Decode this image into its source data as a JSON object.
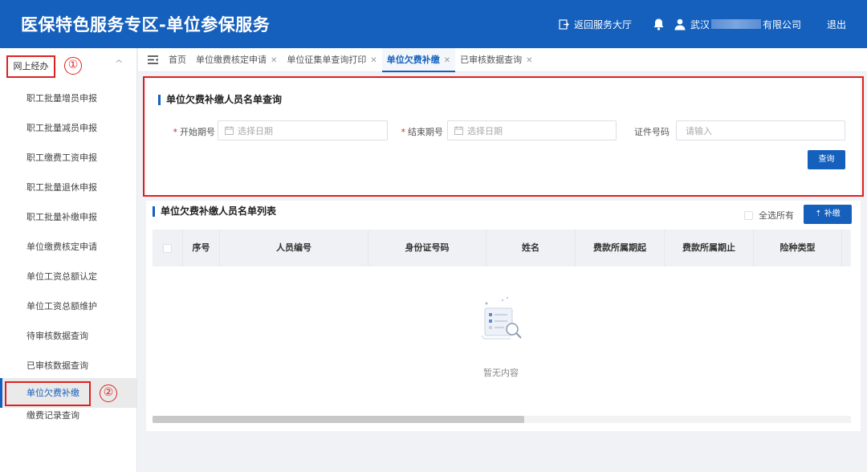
{
  "header": {
    "title": "医保特色服务专区-单位参保服务",
    "return_label": "返回服务大厅",
    "company_prefix": "武汉",
    "company_suffix": "有限公司",
    "logout_label": "退出"
  },
  "sidebar": {
    "group_label": "网上经办",
    "items": [
      {
        "label": "职工批量增员申报"
      },
      {
        "label": "职工批量减员申报"
      },
      {
        "label": "职工缴费工资申报"
      },
      {
        "label": "职工批量退休申报"
      },
      {
        "label": "职工批量补缴申报"
      },
      {
        "label": "单位缴费核定申请"
      },
      {
        "label": "单位工资总额认定"
      },
      {
        "label": "单位工资总额维护"
      },
      {
        "label": "待审核数据查询"
      },
      {
        "label": "已审核数据查询"
      },
      {
        "label": "单位欠费补缴"
      },
      {
        "label": "缴费记录查询"
      }
    ],
    "active_index": 10
  },
  "annotations": {
    "first": "①",
    "second": "②"
  },
  "tabs": [
    {
      "label": "首页",
      "closable": false
    },
    {
      "label": "单位缴费核定申请",
      "closable": true
    },
    {
      "label": "单位征集单查询打印",
      "closable": true
    },
    {
      "label": "单位欠费补缴",
      "closable": true,
      "active": true
    },
    {
      "label": "已审核数据查询",
      "closable": true
    }
  ],
  "query": {
    "title": "单位欠费补缴人员名单查询",
    "start_label": "开始期号",
    "start_placeholder": "选择日期",
    "end_label": "结束期号",
    "end_placeholder": "选择日期",
    "id_label": "证件号码",
    "id_placeholder": "请输入",
    "search_button": "查询"
  },
  "list": {
    "title": "单位欠费补缴人员名单列表",
    "select_all_label": "全选所有",
    "supplement_button": "补缴",
    "columns": [
      "序号",
      "人员编号",
      "身份证号码",
      "姓名",
      "费款所属期起",
      "费款所属期止",
      "险种类型"
    ],
    "empty_text": "暂无内容"
  },
  "colors": {
    "primary": "#1560bd",
    "annotation_red": "#e02020"
  }
}
